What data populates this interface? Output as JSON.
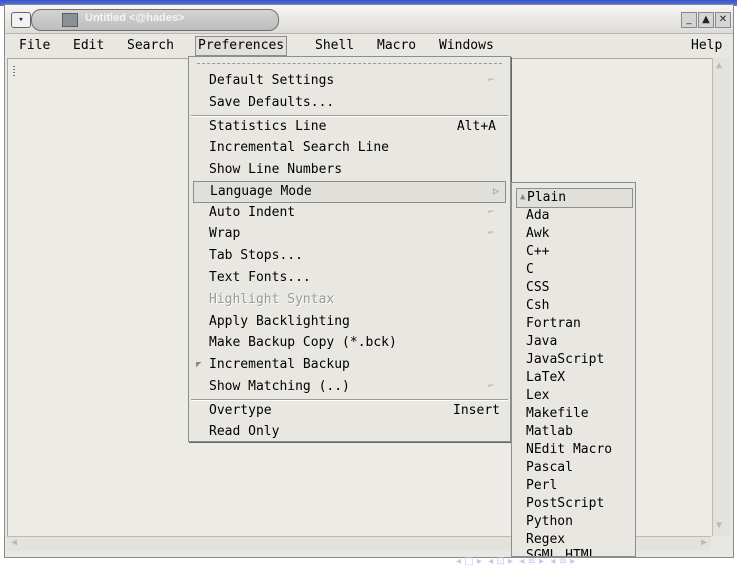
{
  "window": {
    "title": "Untitled <@hades>",
    "menu_button_icon": "chevron-down-icon",
    "controls": [
      "minimize-icon",
      "maximize-icon",
      "close-icon"
    ]
  },
  "menubar": {
    "items": [
      {
        "label": "File"
      },
      {
        "label": "Edit"
      },
      {
        "label": "Search"
      },
      {
        "label": "Preferences"
      },
      {
        "label": "Shell"
      },
      {
        "label": "Macro"
      },
      {
        "label": "Windows"
      },
      {
        "label": "Help"
      }
    ],
    "active": "Preferences"
  },
  "preferences_menu": {
    "items": [
      {
        "label": "Default Settings",
        "submenu": true
      },
      {
        "label": "Save Defaults..."
      },
      {
        "label": "Statistics Line",
        "accel": "Alt+A"
      },
      {
        "label": "Incremental Search Line"
      },
      {
        "label": "Show Line Numbers"
      },
      {
        "label": "Language Mode",
        "submenu": true,
        "highlighted": true
      },
      {
        "label": "Auto Indent",
        "submenu": true
      },
      {
        "label": "Wrap",
        "submenu": true
      },
      {
        "label": "Tab Stops..."
      },
      {
        "label": "Text Fonts..."
      },
      {
        "label": "Highlight Syntax",
        "disabled": true
      },
      {
        "label": "Apply Backlighting"
      },
      {
        "label": "Make Backup Copy (*.bck)"
      },
      {
        "label": "Incremental Backup",
        "checked": true
      },
      {
        "label": "Show Matching (..)",
        "submenu": true
      },
      {
        "label": "Overtype",
        "accel": "Insert"
      },
      {
        "label": "Read Only"
      }
    ]
  },
  "language_submenu": {
    "items": [
      "Plain",
      "Ada",
      "Awk",
      "C++",
      "C",
      "CSS",
      "Csh",
      "Fortran",
      "Java",
      "JavaScript",
      "LaTeX",
      "Lex",
      "Makefile",
      "Matlab",
      "NEdit Macro",
      "Pascal",
      "Perl",
      "PostScript",
      "Python",
      "Regex",
      "SGML HTML"
    ],
    "selected": "Plain"
  },
  "nav_icons": [
    "nav-left-icon",
    "nav-right-icon",
    "nav-frame-icon",
    "nav-section-icon",
    "nav-subsection-icon"
  ]
}
